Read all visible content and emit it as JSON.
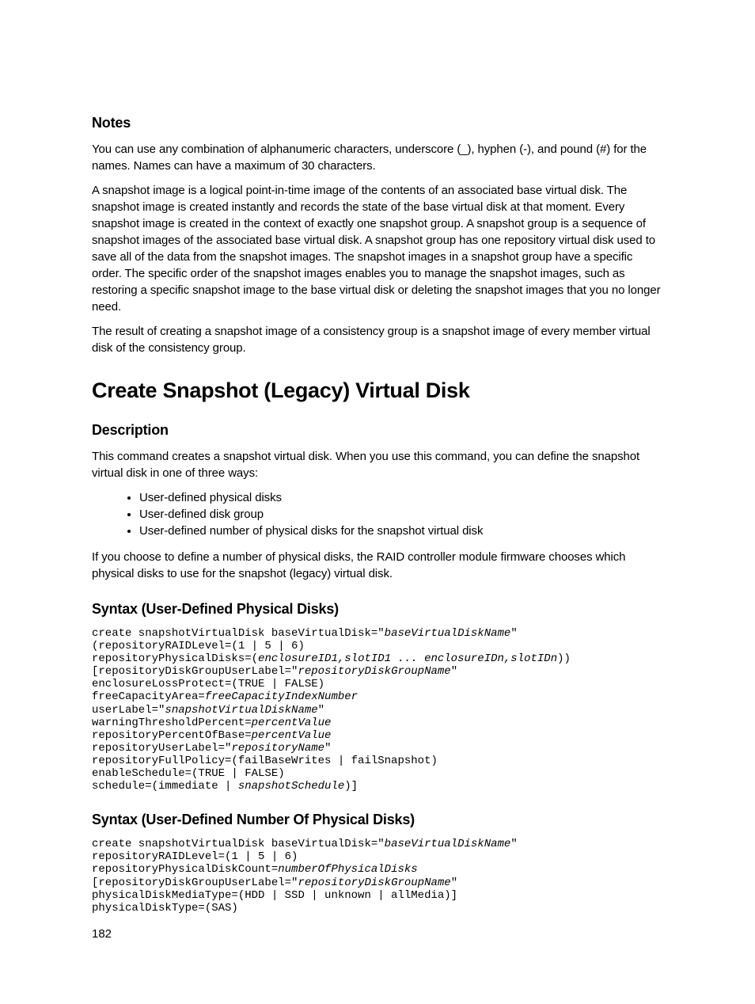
{
  "notes": {
    "heading": "Notes",
    "p1": "You can use any combination of alphanumeric characters, underscore (_), hyphen (-), and pound (#) for the names. Names can have a maximum of 30 characters.",
    "p2": "A snapshot image is a logical point-in-time image of the contents of an associated base virtual disk. The snapshot image is created instantly and records the state of the base virtual disk at that moment. Every snapshot image is created in the context of exactly one snapshot group. A snapshot group is a sequence of snapshot images of the associated base virtual disk. A snapshot group has one repository virtual disk used to save all of the data from the snapshot images. The snapshot images in a snapshot group have a specific order. The specific order of the snapshot images enables you to manage the snapshot images, such as restoring a specific snapshot image to the base virtual disk or deleting the snapshot images that you no longer need.",
    "p3": "The result of creating a snapshot image of a consistency group is a snapshot image of every member virtual disk of the consistency group."
  },
  "title": "Create Snapshot (Legacy) Virtual Disk",
  "description": {
    "heading": "Description",
    "intro": "This command creates a snapshot virtual disk. When you use this command, you can define the snapshot virtual disk in one of three ways:",
    "bullets": [
      "User-defined physical disks",
      "User-defined disk group",
      "User-defined number of physical disks for the snapshot virtual disk"
    ],
    "outro": "If you choose to define a number of physical disks, the RAID controller module firmware chooses which physical disks to use for the snapshot (legacy) virtual disk."
  },
  "syntax1": {
    "heading": "Syntax (User-Defined Physical Disks)",
    "code": {
      "l1a": "create snapshotVirtualDisk baseVirtualDisk=\"",
      "l1b": "baseVirtualDiskName",
      "l1c": "\"",
      "l2": "(repositoryRAIDLevel=(1 | 5 | 6)",
      "l3a": "repositoryPhysicalDisks=(",
      "l3b": "enclosureID1,slotID1 ... enclosureIDn,slotIDn",
      "l3c": "))",
      "l4a": "[repositoryDiskGroupUserLabel=\"",
      "l4b": "repositoryDiskGroupName",
      "l4c": "\"",
      "l5": "enclosureLossProtect=(TRUE | FALSE)",
      "l6a": "freeCapacityArea=",
      "l6b": "freeCapacityIndexNumber",
      "l7a": "userLabel=\"",
      "l7b": "snapshotVirtualDiskName",
      "l7c": "\"",
      "l8a": "warningThresholdPercent=",
      "l8b": "percentValue",
      "l9a": "repositoryPercentOfBase=",
      "l9b": "percentValue",
      "l10a": "repositoryUserLabel=\"",
      "l10b": "repositoryName",
      "l10c": "\"",
      "l11": "repositoryFullPolicy=(failBaseWrites | failSnapshot)",
      "l12": "enableSchedule=(TRUE | FALSE)",
      "l13a": "schedule=(immediate | ",
      "l13b": "snapshotSchedule",
      "l13c": ")]"
    }
  },
  "syntax2": {
    "heading": "Syntax (User-Defined Number Of Physical Disks)",
    "code": {
      "l1a": "create snapshotVirtualDisk baseVirtualDisk=\"",
      "l1b": "baseVirtualDiskName",
      "l1c": "\"",
      "l2": "repositoryRAIDLevel=(1 | 5 | 6)",
      "l3a": "repositoryPhysicalDiskCount=",
      "l3b": "numberOfPhysicalDisks",
      "l4a": "[repositoryDiskGroupUserLabel=\"",
      "l4b": "repositoryDiskGroupName",
      "l4c": "\"",
      "l5": "physicalDiskMediaType=(HDD | SSD | unknown | allMedia)]",
      "l6": "physicalDiskType=(SAS)"
    }
  },
  "pageNumber": "182"
}
